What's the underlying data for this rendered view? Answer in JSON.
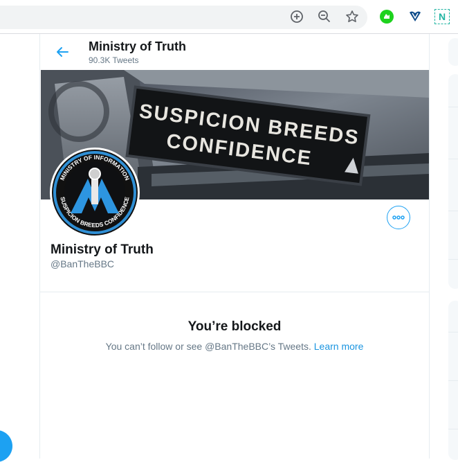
{
  "browser": {
    "zoom_in_icon": "zoom-in-icon",
    "zoom_out_icon": "zoom-out-icon",
    "bookmark_icon": "star-icon",
    "extensions": [
      "green-extension-icon",
      "heart-extension-icon",
      "n-extension-icon"
    ],
    "extension_n_label": "N"
  },
  "header": {
    "title": "Ministry of Truth",
    "tweet_count": "90.3K Tweets"
  },
  "banner": {
    "line1": "SUSPICION BREEDS",
    "line2": "CONFIDENCE"
  },
  "avatar": {
    "ring_text_top": "MINISTRY OF INFORMATION",
    "ring_text_bottom": "SUSPICION BREEDS CONFIDENCE"
  },
  "profile": {
    "name": "Ministry of Truth",
    "handle": "@BanTheBBC"
  },
  "blocked": {
    "title": "You’re blocked",
    "message": "You can’t follow or see @BanTheBBC’s Tweets.",
    "link": "Learn more"
  },
  "colors": {
    "accent": "#1da1f2",
    "text": "#14171a",
    "muted": "#657786"
  }
}
